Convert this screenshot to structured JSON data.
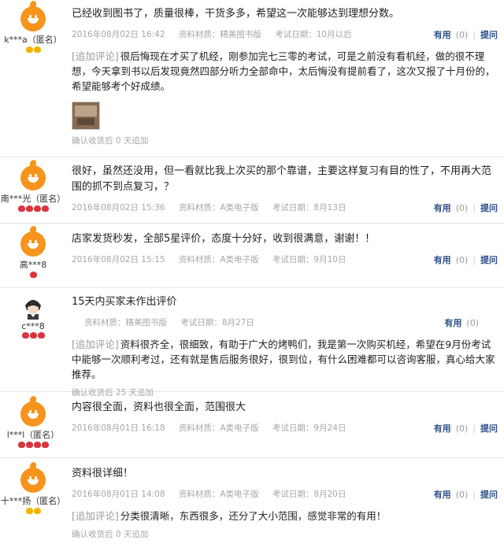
{
  "labels": {
    "useful": "有用",
    "ask": "提问",
    "append_tag": "[追加评论]"
  },
  "reviews": [
    {
      "user": "k***a（匿名）",
      "text": "已经收到图书了，质量很棒，干货多多，希望这一次能够达到理想分数。",
      "date": "2016年08月02日 16:42",
      "material": "资料材质：精美图书版",
      "exam_date": "考试日期：10月以后",
      "useful_count": "(0)",
      "append": "很后悔现在才买了机经，刚参加完七三零的考试，可是之前没有看机经，做的很不理想，今天拿到书以后发现竟然四部分听力全部命中，太后悔没有提前看了，这次又报了十月份的，希望能够考个好成绩。",
      "confirm": "确认收货后 0 天追加"
    },
    {
      "user": "南***光（匿名）",
      "text": "很好，虽然还没用，但一看就比我上次买的那个靠谱，主要这样复习有目的性了，不用再大范围的抓不到点复习，？",
      "date": "2016年08月02日 15:36",
      "material": "资料材质：A类电子版",
      "exam_date": "考试日期：8月13日",
      "useful_count": "(0)"
    },
    {
      "user": "高***8",
      "text": "店家发货秒发，全部5星评价，态度十分好，收到很满意，谢谢！！",
      "date": "2016年08月02日 15:15",
      "material": "资料材质：A类电子版",
      "exam_date": "考试日期：9月10日",
      "useful_count": "(0)"
    },
    {
      "user": "c***8",
      "text": "15天内买家未作出评价",
      "material": "资料材质：精美图书版",
      "exam_date": "考试日期：8月27日",
      "useful_count": "(0)",
      "append": "资料很齐全，很细致，有助于广大的烤鸭们，我是第一次购买机经，希望在9月份考试中能够一次顺利考过，还有就是售后服务很好，很到位，有什么困难都可以咨询客服，真心给大家推荐。",
      "confirm": "确认收货后 25 天追加"
    },
    {
      "user": "l***l（匿名）",
      "text": "内容很全面，资料也很全面，范围很大",
      "date": "2016年08月01日 16:18",
      "material": "资料材质：A类电子版",
      "exam_date": "考试日期：9月24日",
      "useful_count": "(0)"
    },
    {
      "user": "十***扬（匿名）",
      "text": "资料很详细！",
      "date": "2016年08月01日 14:08",
      "material": "资料材质：A类电子版",
      "exam_date": "考试日期：8月20日",
      "useful_count": "(0)",
      "append": "分类很清晰，东西很多，还分了大小范围，感觉非常的有用！",
      "confirm": "确认收货后 0 天追加"
    }
  ]
}
